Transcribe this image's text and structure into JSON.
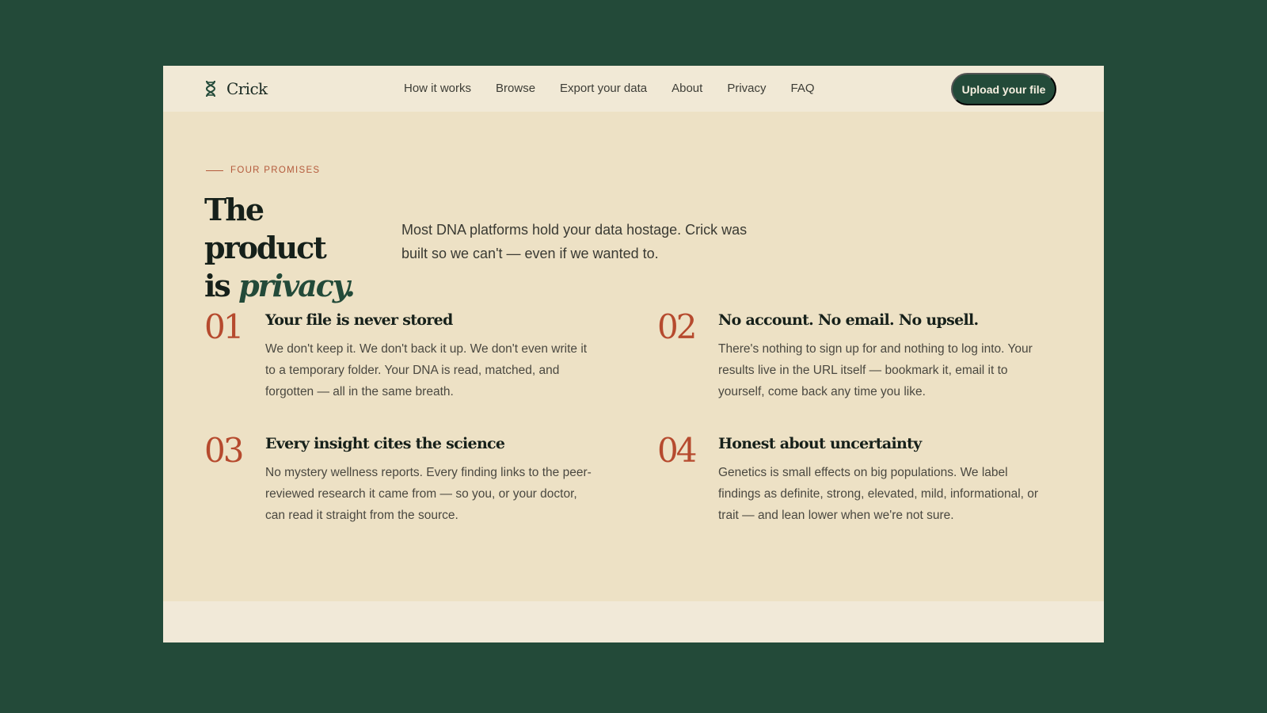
{
  "brand": {
    "name": "Crick",
    "icon": "dna-helix-icon"
  },
  "nav": {
    "links": [
      "How it works",
      "Browse",
      "Export your data",
      "About",
      "Privacy",
      "FAQ"
    ],
    "cta_label": "Upload your file"
  },
  "section": {
    "eyebrow": "FOUR PROMISES",
    "headline_line1": "The product",
    "headline_is": "is ",
    "headline_emph": "privacy.",
    "lede": "Most DNA platforms hold your data hostage. Crick was built so we can't — even if we wanted to."
  },
  "promises": [
    {
      "number": "01",
      "title": "Your file is never stored",
      "body": "We don't keep it. We don't back it up. We don't even write it to a temporary folder. Your DNA is read, matched, and forgotten — all in the same breath."
    },
    {
      "number": "02",
      "title": "No account. No email. No upsell.",
      "body": "There's nothing to sign up for and nothing to log into. Your results live in the URL itself — bookmark it, email it to yourself, come back any time you like."
    },
    {
      "number": "03",
      "title": "Every insight cites the science",
      "body": "No mystery wellness reports. Every finding links to the peer-reviewed research it came from — so you, or your doctor, can read it straight from the source."
    },
    {
      "number": "04",
      "title": "Honest about uncertainty",
      "body": "Genetics is small effects on big populations. We label findings as definite, strong, elevated, mild, informational, or trait — and lean lower when we're not sure."
    }
  ],
  "colors": {
    "outer_background": "#234a39",
    "page_background": "#ede1c5",
    "nav_background": "#f1e9d6",
    "accent_green": "#234a39",
    "accent_rust": "#b64a2e"
  }
}
